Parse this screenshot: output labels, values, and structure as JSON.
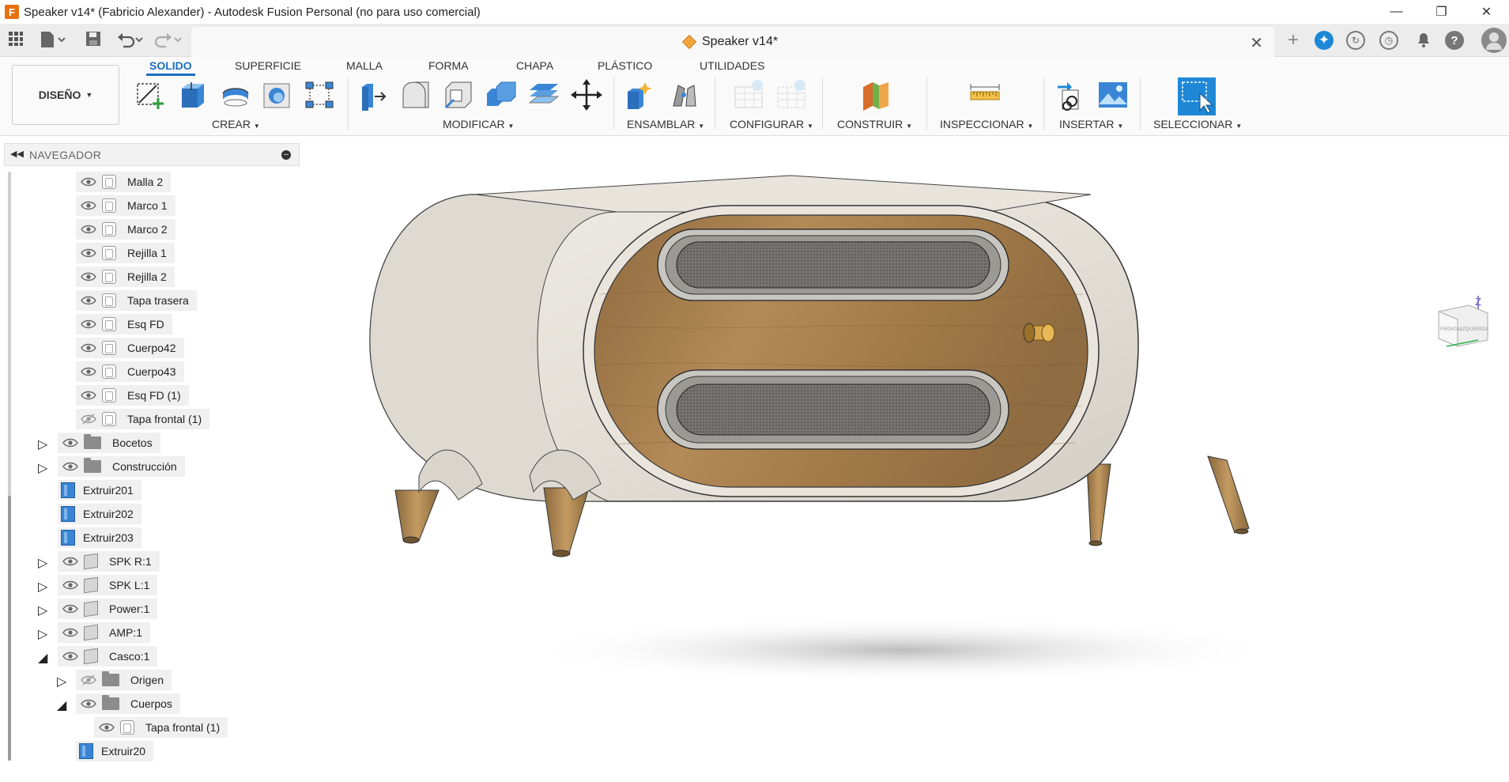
{
  "window": {
    "title": "Speaker v14* (Fabricio Alexander) - Autodesk Fusion Personal (no para uso comercial)",
    "app_icon_letter": "F",
    "controls": [
      "minimize-icon",
      "restore-icon",
      "close-icon"
    ]
  },
  "quickbar": {
    "icons": [
      "grid-icon",
      "file-icon",
      "save-icon",
      "undo-icon",
      "redo-icon"
    ],
    "document_tab": {
      "label": "Speaker v14*"
    },
    "right_icons": [
      "new-tab-icon",
      "extensions-icon",
      "online-icon",
      "job-status-icon",
      "notifications-icon",
      "help-icon",
      "user-avatar-icon"
    ]
  },
  "ribbon": {
    "workspace": "DISEÑO",
    "tabs": [
      {
        "label": "SOLIDO",
        "active": true
      },
      {
        "label": "SUPERFICIE"
      },
      {
        "label": "MALLA"
      },
      {
        "label": "FORMA"
      },
      {
        "label": "CHAPA"
      },
      {
        "label": "PLÁSTICO"
      },
      {
        "label": "UTILIDADES"
      }
    ],
    "groups": [
      {
        "label": "CREAR"
      },
      {
        "label": "MODIFICAR"
      },
      {
        "label": "ENSAMBLAR"
      },
      {
        "label": "CONFIGURAR"
      },
      {
        "label": "CONSTRUIR"
      },
      {
        "label": "INSPECCIONAR"
      },
      {
        "label": "INSERTAR"
      },
      {
        "label": "SELECCIONAR"
      }
    ]
  },
  "navigator": {
    "title": "NAVEGADOR",
    "items": [
      {
        "label": "Malla 2",
        "type": "body",
        "visible": true
      },
      {
        "label": "Marco 1",
        "type": "body",
        "visible": true
      },
      {
        "label": "Marco 2",
        "type": "body",
        "visible": true
      },
      {
        "label": "Rejilla 1",
        "type": "body",
        "visible": true
      },
      {
        "label": "Rejilla 2",
        "type": "body",
        "visible": true
      },
      {
        "label": "Tapa trasera",
        "type": "body",
        "visible": true
      },
      {
        "label": "Esq FD",
        "type": "body",
        "visible": true
      },
      {
        "label": "Cuerpo42",
        "type": "body",
        "visible": true
      },
      {
        "label": "Cuerpo43",
        "type": "body",
        "visible": true
      },
      {
        "label": "Esq FD (1)",
        "type": "body",
        "visible": true
      },
      {
        "label": "Tapa frontal (1)",
        "type": "body",
        "visible": false
      },
      {
        "label": "Bocetos",
        "type": "folder",
        "visible": true
      },
      {
        "label": "Construcción",
        "type": "folder",
        "visible": true
      },
      {
        "label": "Extruir201",
        "type": "feature"
      },
      {
        "label": "Extruir202",
        "type": "feature"
      },
      {
        "label": "Extruir203",
        "type": "feature"
      },
      {
        "label": "SPK R:1",
        "type": "component",
        "visible": true
      },
      {
        "label": "SPK L:1",
        "type": "component",
        "visible": true
      },
      {
        "label": "Power:1",
        "type": "component",
        "visible": true
      },
      {
        "label": "AMP:1",
        "type": "component",
        "visible": true
      },
      {
        "label": "Casco:1",
        "type": "component",
        "visible": true
      },
      {
        "label": "Origen",
        "type": "folder",
        "visible": false
      },
      {
        "label": "Cuerpos",
        "type": "folder",
        "visible": true
      },
      {
        "label": "Tapa frontal (1)",
        "type": "body",
        "visible": true
      },
      {
        "label": "Extruir20",
        "type": "feature"
      }
    ]
  },
  "viewcube": {
    "faces": [
      "FRONTAL",
      "IZQUIERDA"
    ],
    "axis": "Z"
  },
  "colors": {
    "accent": "#1b6fc2",
    "wood": "#a9804e",
    "shell": "#e4e0d8",
    "grille": "#6d6d6a"
  }
}
